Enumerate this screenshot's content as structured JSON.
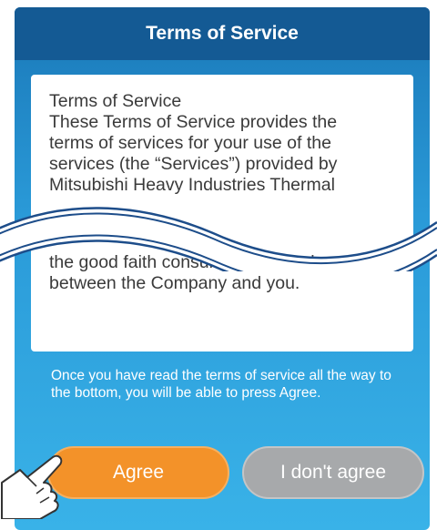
{
  "header": {
    "title": "Terms of Service"
  },
  "terms": {
    "lines_top": [
      "Terms of Service",
      "These Terms of Service provides the",
      "terms of services for your use of the",
      "services (the “Services”) provided by",
      "Mitsubishi Heavy Industries Thermal"
    ],
    "lines_bottom": [
      "the good faith consultation by and",
      "between the Company and you."
    ]
  },
  "notice": {
    "text": "Once you have read the terms of service all the way to the bottom, you will be able to press Agree."
  },
  "buttons": {
    "agree_label": "Agree",
    "disagree_label": "I don't agree"
  },
  "icons": {
    "wave": "wavy-break-icon",
    "hand": "pointing-hand-icon"
  },
  "colors": {
    "header_bg": "#145a94",
    "panel_top": "#1a78b8",
    "panel_bottom": "#39b2e8",
    "agree_bg": "#f39229",
    "disagree_bg": "#a7a9ab"
  }
}
